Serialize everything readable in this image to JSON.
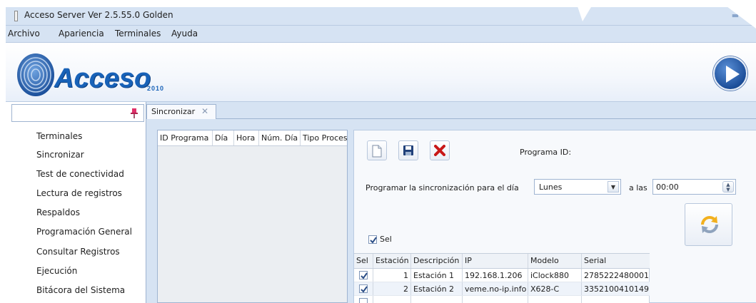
{
  "window": {
    "title": "Acceso Server Ver 2.5.55.0 Golden"
  },
  "menu": [
    {
      "label": "Archivo"
    },
    {
      "label": "Apariencia"
    },
    {
      "label": "Terminales"
    },
    {
      "label": "Ayuda"
    }
  ],
  "logo": {
    "word": "Acceso",
    "year": "2010"
  },
  "sidebar": {
    "items": [
      {
        "label": "Terminales"
      },
      {
        "label": "Sincronizar"
      },
      {
        "label": "Test de conectividad"
      },
      {
        "label": "Lectura de registros"
      },
      {
        "label": "Respaldos"
      },
      {
        "label": "Programación General"
      },
      {
        "label": "Consultar Registros"
      },
      {
        "label": "Ejecución"
      },
      {
        "label": "Bitácora del Sistema"
      }
    ]
  },
  "tab": {
    "label": "Sincronizar",
    "close": "✕"
  },
  "program_grid": {
    "columns": [
      "ID Programa",
      "Día",
      "Hora",
      "Núm. Día",
      "Tipo Proces"
    ]
  },
  "form": {
    "program_id_label": "Programa ID:",
    "schedule_label": "Programar la sincronización para el día",
    "day_value": "Lunes",
    "at_label": "a las",
    "time_value": "00:00",
    "sel_label": "Sel",
    "sel_checked": true
  },
  "station_grid": {
    "columns": [
      "Sel",
      "Estación",
      "Descripción",
      "IP",
      "Modelo",
      "Serial"
    ],
    "rows": [
      {
        "sel": true,
        "station": "1",
        "description": "Estación 1",
        "ip": "192.168.1.206",
        "model": "iClock880",
        "serial": "2785222480001"
      },
      {
        "sel": true,
        "station": "2",
        "description": "Estación 2",
        "ip": "veme.no-ip.info",
        "model": "X628-C",
        "serial": "3352100410149"
      }
    ]
  },
  "colors": {
    "accent": "#1862b8",
    "panel": "#d6e3f3",
    "border": "#9fb4d1"
  },
  "icons": [
    "pin-icon",
    "new-document-icon",
    "save-icon",
    "delete-icon",
    "sync-icon",
    "play-icon",
    "fingerprint-icon",
    "checkbox-icon"
  ]
}
